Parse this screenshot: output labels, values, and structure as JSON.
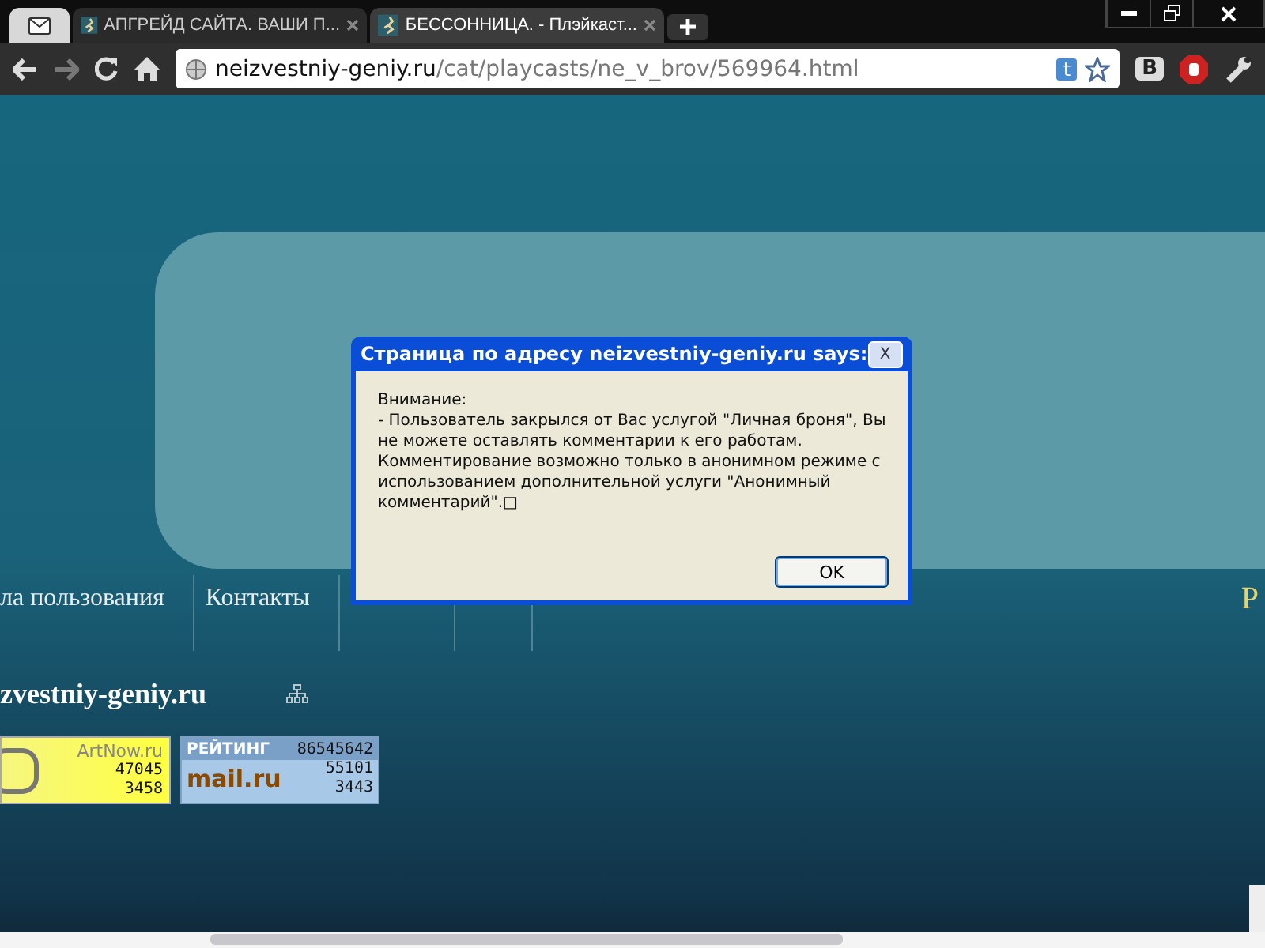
{
  "browser": {
    "tabs": [
      {
        "title": "АПГРЕЙД САЙТА. ВАШИ П...",
        "selected": false
      },
      {
        "title": "БЕССОННИЦА. - Плэйкаст...",
        "selected": true
      }
    ],
    "address": {
      "host": "neizvestniy-geniy.ru",
      "path": "/cat/playcasts/ne_v_brov/569964.html"
    },
    "ext_badge": "t",
    "vk_button": "B"
  },
  "page": {
    "nav": [
      "ла пользования",
      "Контакты"
    ],
    "nav_edge": "Р",
    "site_name": "zvestniy-geniy.ru",
    "counters": [
      {
        "kind": "artnow",
        "brand": "ArtNow.ru",
        "values": [
          "47045",
          "3458"
        ]
      },
      {
        "kind": "mailru",
        "title": "РЕЙТИНГ",
        "total": "86545642",
        "brand": "mail.ru",
        "values": [
          "55101",
          "3443"
        ]
      }
    ]
  },
  "dialog": {
    "title": "Страница по адресу neizvestniy-geniy.ru says:",
    "close": "X",
    "lines": [
      "Внимание:",
      "- Пользователь закрылся от Вас услугой \"Личная броня\", Вы не можете оставлять комментарии к его работам. Комментирование возможно только в анонимном режиме с использованием дополнительной услуги \"Анонимный комментарий\".□"
    ],
    "button": "OK"
  }
}
